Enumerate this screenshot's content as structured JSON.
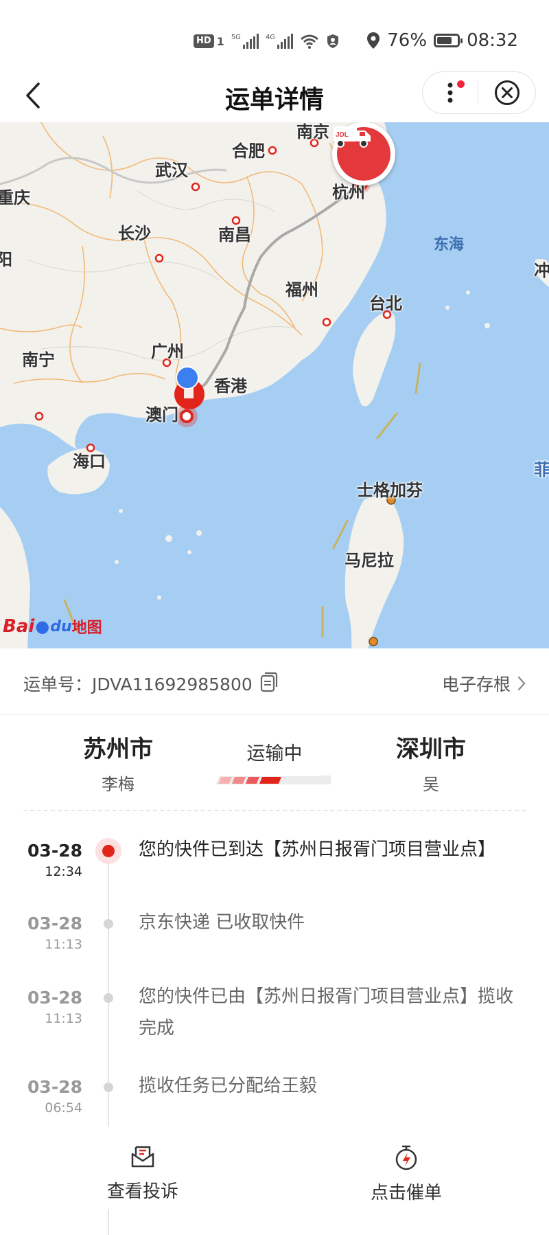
{
  "status_bar": {
    "hd": "HD",
    "sim1": "1",
    "net1": "5G",
    "net2": "4G",
    "battery": "76%",
    "battery_level": 0.76,
    "time": "08:32"
  },
  "nav": {
    "title": "运单详情"
  },
  "map": {
    "labels": {
      "nanjing": "南京",
      "hefei": "合肥",
      "wuhan": "武汉",
      "chongqing": "重庆",
      "hangzhou": "杭州",
      "changsha": "长沙",
      "nanchang": "南昌",
      "fuzhou": "福州",
      "taibei": "台北",
      "guangzhou": "广州",
      "nanning": "南宁",
      "xianggang": "香港",
      "aomen": "澳门",
      "haikou": "海口",
      "shigejiafang": "士格加芬",
      "manila": "马尼拉",
      "yang": "阳",
      "chong": "冲",
      "fei": "菲"
    },
    "sea": "东海",
    "logo_bai": "Bai",
    "logo_du": "du",
    "logo_map": "地图",
    "truck_badge": "JDL"
  },
  "waybill": {
    "label": "运单号：JDVA11692985800",
    "stub": "电子存根"
  },
  "route": {
    "from_city": "苏州市",
    "from_person": "李梅",
    "status": "运输中",
    "to_city": "深圳市",
    "to_person": "吴"
  },
  "timeline": [
    {
      "date": "03-28",
      "time": "12:34",
      "text": "您的快件已到达【苏州日报胥门项目营业点】"
    },
    {
      "date": "03-28",
      "time": "11:13",
      "text": "京东快递 已收取快件"
    },
    {
      "date": "03-28",
      "time": "11:13",
      "text": "您的快件已由【苏州日报胥门项目营业点】揽收完成"
    },
    {
      "date": "03-28",
      "time": "06:54",
      "text": "揽收任务已分配给王毅"
    }
  ],
  "bottom": {
    "complaint": "查看投诉",
    "urge": "点击催单"
  },
  "colors": {
    "accent": "#e1251b",
    "sea": "#a6cef2",
    "land": "#f3f1ec"
  }
}
